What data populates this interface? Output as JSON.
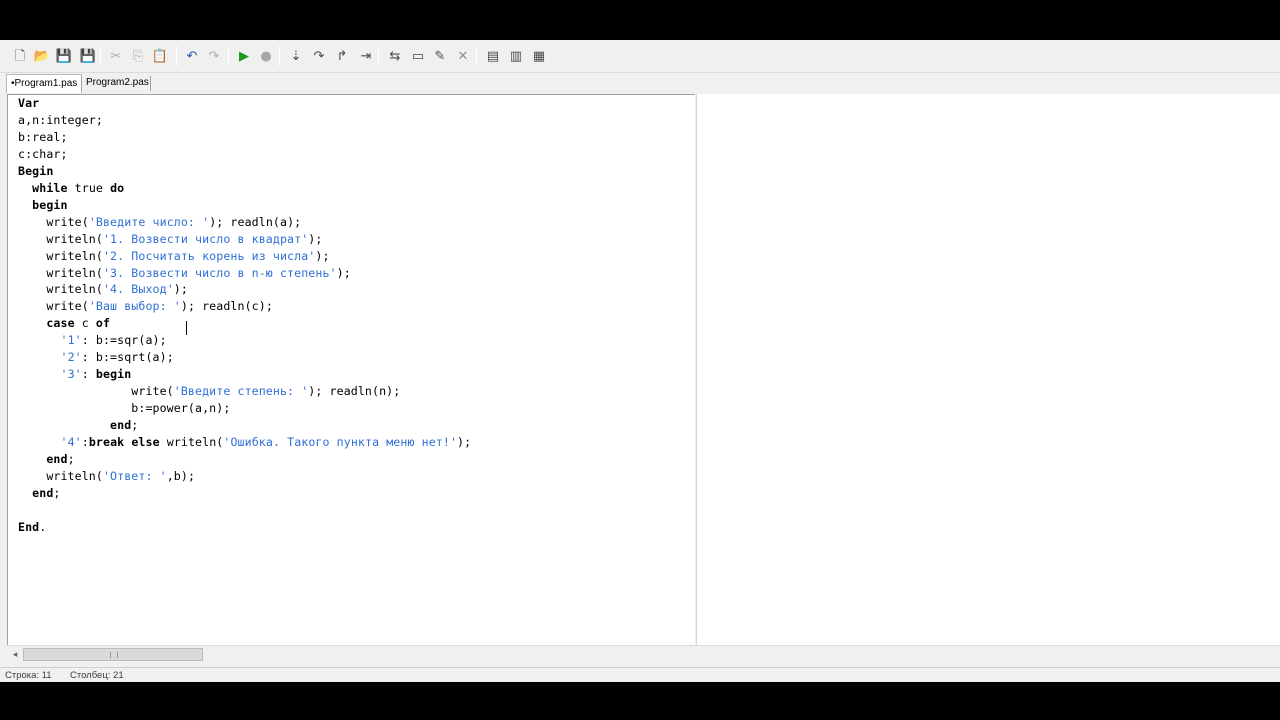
{
  "toolbar": {
    "buttons": [
      {
        "name": "new-file-icon",
        "glyph": "🗋"
      },
      {
        "name": "open-folder-icon",
        "glyph": "📂"
      },
      {
        "name": "save-icon",
        "glyph": "💾"
      },
      {
        "name": "save-all-icon",
        "glyph": "💾"
      },
      {
        "name": "cut-icon",
        "glyph": "✂"
      },
      {
        "name": "copy-icon",
        "glyph": "⎘"
      },
      {
        "name": "paste-icon",
        "glyph": "📋"
      },
      {
        "name": "undo-icon",
        "glyph": "↶"
      },
      {
        "name": "redo-icon",
        "glyph": "↷"
      },
      {
        "name": "run-icon",
        "glyph": "▶"
      },
      {
        "name": "stop-icon",
        "glyph": "●"
      },
      {
        "name": "step-into-icon",
        "glyph": "⇣"
      },
      {
        "name": "step-over-icon",
        "glyph": "↷"
      },
      {
        "name": "step-out-icon",
        "glyph": "↱"
      },
      {
        "name": "run-to-cursor-icon",
        "glyph": "⇥"
      },
      {
        "name": "watch-icon",
        "glyph": "⇆"
      },
      {
        "name": "window-icon",
        "glyph": "▭"
      },
      {
        "name": "edit-icon",
        "glyph": "✎"
      },
      {
        "name": "close-icon",
        "glyph": "✕"
      },
      {
        "name": "layout-1-icon",
        "glyph": "▤"
      },
      {
        "name": "layout-2-icon",
        "glyph": "▥"
      },
      {
        "name": "layout-3-icon",
        "glyph": "▦"
      }
    ]
  },
  "tabs": [
    {
      "label": "•Program1.pas"
    },
    {
      "label": "Program2.pas"
    }
  ],
  "editor": {
    "lines": [
      [
        {
          "t": "Var",
          "c": "kw"
        }
      ],
      [
        {
          "t": "a,n:integer;",
          "c": ""
        }
      ],
      [
        {
          "t": "b:real;",
          "c": ""
        }
      ],
      [
        {
          "t": "c:char;",
          "c": ""
        }
      ],
      [
        {
          "t": "Begin",
          "c": "kw"
        }
      ],
      [
        {
          "t": "  ",
          "c": ""
        },
        {
          "t": "while",
          "c": "kw"
        },
        {
          "t": " true ",
          "c": ""
        },
        {
          "t": "do",
          "c": "kw"
        }
      ],
      [
        {
          "t": "  ",
          "c": ""
        },
        {
          "t": "begin",
          "c": "kw"
        }
      ],
      [
        {
          "t": "    write(",
          "c": ""
        },
        {
          "t": "'Введите число: '",
          "c": "str"
        },
        {
          "t": "); readln(a);",
          "c": ""
        }
      ],
      [
        {
          "t": "    writeln(",
          "c": ""
        },
        {
          "t": "'1. Возвести число в квадрат'",
          "c": "str"
        },
        {
          "t": ");",
          "c": ""
        }
      ],
      [
        {
          "t": "    writeln(",
          "c": ""
        },
        {
          "t": "'2. Посчитать корень из числа'",
          "c": "str"
        },
        {
          "t": ");",
          "c": ""
        }
      ],
      [
        {
          "t": "    writeln(",
          "c": ""
        },
        {
          "t": "'3. Возвести число в n-ю степень'",
          "c": "str"
        },
        {
          "t": ");",
          "c": ""
        }
      ],
      [
        {
          "t": "    writeln(",
          "c": ""
        },
        {
          "t": "'4. Выход'",
          "c": "str"
        },
        {
          "t": ");",
          "c": ""
        }
      ],
      [
        {
          "t": "    write(",
          "c": ""
        },
        {
          "t": "'Ваш выбор: '",
          "c": "str"
        },
        {
          "t": "); readln(c);",
          "c": ""
        }
      ],
      [
        {
          "t": "    ",
          "c": ""
        },
        {
          "t": "case",
          "c": "kw"
        },
        {
          "t": " c ",
          "c": ""
        },
        {
          "t": "of",
          "c": "kw"
        }
      ],
      [
        {
          "t": "      ",
          "c": ""
        },
        {
          "t": "'1'",
          "c": "str"
        },
        {
          "t": ": b:=sqr(a);",
          "c": ""
        }
      ],
      [
        {
          "t": "      ",
          "c": ""
        },
        {
          "t": "'2'",
          "c": "str"
        },
        {
          "t": ": b:=sqrt(a);",
          "c": ""
        }
      ],
      [
        {
          "t": "      ",
          "c": ""
        },
        {
          "t": "'3'",
          "c": "str"
        },
        {
          "t": ": ",
          "c": ""
        },
        {
          "t": "begin",
          "c": "kw"
        }
      ],
      [
        {
          "t": "                write(",
          "c": ""
        },
        {
          "t": "'Введите степень: '",
          "c": "str"
        },
        {
          "t": "); readln(n);",
          "c": ""
        }
      ],
      [
        {
          "t": "                b:=power(a,n);",
          "c": ""
        }
      ],
      [
        {
          "t": "             ",
          "c": ""
        },
        {
          "t": "end",
          "c": "kw"
        },
        {
          "t": ";",
          "c": ""
        }
      ],
      [
        {
          "t": "      ",
          "c": ""
        },
        {
          "t": "'4'",
          "c": "str"
        },
        {
          "t": ":",
          "c": ""
        },
        {
          "t": "break",
          "c": "kw"
        },
        {
          "t": " ",
          "c": ""
        },
        {
          "t": "else",
          "c": "kw"
        },
        {
          "t": " writeln(",
          "c": ""
        },
        {
          "t": "'Ошибка. Такого пункта меню нет!'",
          "c": "str"
        },
        {
          "t": ");",
          "c": ""
        }
      ],
      [
        {
          "t": "    ",
          "c": ""
        },
        {
          "t": "end",
          "c": "kw"
        },
        {
          "t": ";",
          "c": ""
        }
      ],
      [
        {
          "t": "    writeln(",
          "c": ""
        },
        {
          "t": "'Ответ: '",
          "c": "str"
        },
        {
          "t": ",b);",
          "c": ""
        }
      ],
      [
        {
          "t": "  ",
          "c": ""
        },
        {
          "t": "end",
          "c": "kw"
        },
        {
          "t": ";",
          "c": ""
        }
      ],
      [
        {
          "t": "",
          "c": ""
        }
      ],
      [
        {
          "t": "End",
          "c": "kw"
        },
        {
          "t": ".",
          "c": ""
        }
      ]
    ]
  },
  "status": {
    "row_label": "Строка: 11",
    "col_label": "Столбец: 21"
  }
}
